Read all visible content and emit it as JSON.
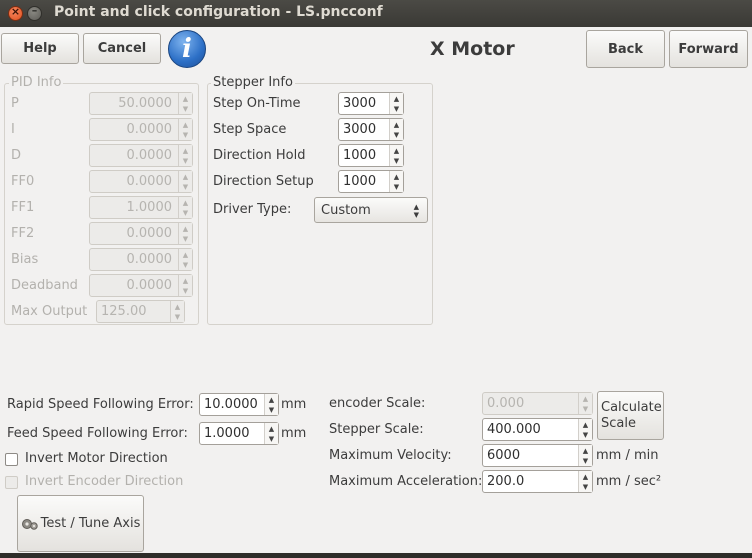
{
  "window": {
    "title": "Point and click configuration - LS.pncconf",
    "close_glyph": "×",
    "minimize_glyph": "–"
  },
  "toolbar": {
    "help_label": "Help",
    "cancel_label": "Cancel",
    "info_glyph": "i",
    "heading": "X Motor",
    "back_label": "Back",
    "forward_label": "Forward"
  },
  "pid_info": {
    "title": "PID Info",
    "rows": [
      {
        "label": "P",
        "value": "50.0000"
      },
      {
        "label": "I",
        "value": "0.0000"
      },
      {
        "label": "D",
        "value": "0.0000"
      },
      {
        "label": "FF0",
        "value": "0.0000"
      },
      {
        "label": "FF1",
        "value": "1.0000"
      },
      {
        "label": "FF2",
        "value": "0.0000"
      },
      {
        "label": "Bias",
        "value": "0.0000"
      },
      {
        "label": "Deadband",
        "value": "0.0000"
      },
      {
        "label": "Max Output",
        "value": "125.00"
      }
    ]
  },
  "stepper_info": {
    "title": "Stepper Info",
    "rows": [
      {
        "label": "Step On-Time",
        "value": "3000"
      },
      {
        "label": "Step Space",
        "value": "3000"
      },
      {
        "label": "Direction Hold",
        "value": "1000"
      },
      {
        "label": "Direction Setup",
        "value": "1000"
      }
    ],
    "driver_type_label": "Driver Type:",
    "driver_type_value": "Custom"
  },
  "following": {
    "rapid_label": "Rapid Speed Following Error:",
    "rapid_value": "10.0000",
    "rapid_unit": "mm",
    "feed_label": "Feed Speed Following Error:",
    "feed_value": "1.0000",
    "feed_unit": "mm"
  },
  "options": {
    "invert_motor_label": "Invert Motor Direction",
    "invert_encoder_label": "Invert Encoder Direction"
  },
  "scale": {
    "encoder_label": "encoder Scale:",
    "encoder_value": "0.000",
    "stepper_label": "Stepper Scale:",
    "stepper_value": "400.000",
    "max_vel_label": "Maximum Velocity:",
    "max_vel_value": "6000",
    "max_vel_unit": "mm / min",
    "max_acc_label": "Maximum Acceleration:",
    "max_acc_value": "200.0",
    "max_acc_unit": "mm / sec²",
    "calc_label_1": "Calculate",
    "calc_label_2": "Scale"
  },
  "test_tune_label": "Test / Tune Axis",
  "spin_arrows": "▲\n▼",
  "combo_arrows": "▲\n▼"
}
